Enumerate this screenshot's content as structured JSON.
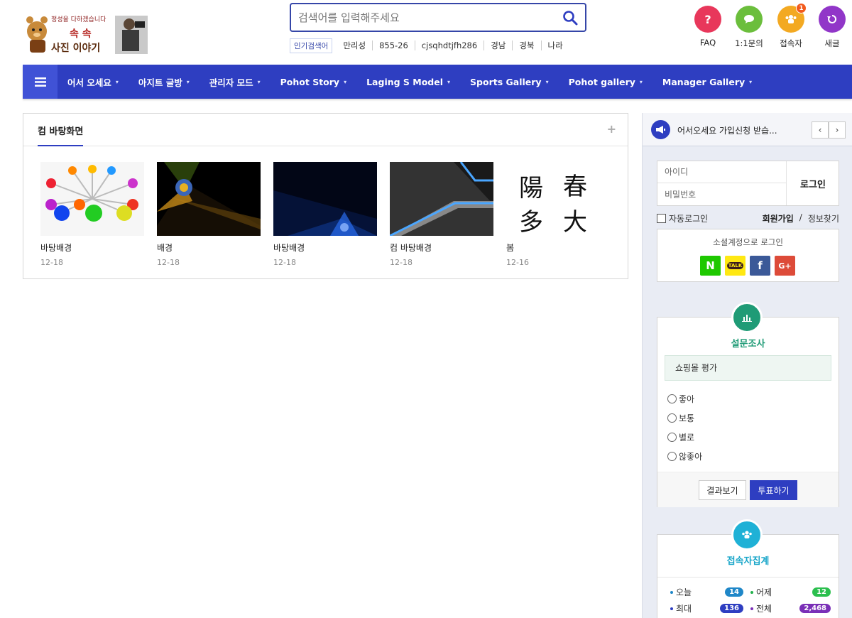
{
  "logo": {
    "line1": "정성을 다하겠습니다",
    "line2": "속 속",
    "line3": "사진 이야기"
  },
  "search": {
    "placeholder": "검색어를 입력해주세요",
    "value": ""
  },
  "popular": {
    "tag": "인기검색어",
    "keywords": [
      "만리성",
      "855-26",
      "cjsqhdtjfh286",
      "경남",
      "경북",
      "나라"
    ]
  },
  "quick_links": [
    {
      "label": "FAQ",
      "icon": "question-icon",
      "color": "#e8375b"
    },
    {
      "label": "1:1문의",
      "icon": "chat-icon",
      "color": "#6bbe3c"
    },
    {
      "label": "접속자",
      "icon": "users-icon",
      "color": "#f3a922",
      "badge": "1"
    },
    {
      "label": "새글",
      "icon": "refresh-icon",
      "color": "#9136c8"
    }
  ],
  "nav": {
    "items": [
      "어서 오세요",
      "아지트 글방",
      "관리자 모드",
      "Pohot Story",
      "Laging S Model",
      "Sports Gallery",
      "Pohot gallery",
      "Manager Gallery"
    ],
    "bg": "#2e3ec1"
  },
  "main": {
    "title": "컴 바탕화면",
    "items": [
      {
        "title": "바탕배경",
        "date": "12-18"
      },
      {
        "title": "배경",
        "date": "12-18"
      },
      {
        "title": "바탕배경",
        "date": "12-18"
      },
      {
        "title": "컴 바탕배경",
        "date": "12-18"
      },
      {
        "title": "봄",
        "date": "12-16"
      }
    ]
  },
  "sidebar": {
    "notice": "어서오세요 가입신청 받습...",
    "login": {
      "id_placeholder": "아이디",
      "pw_placeholder": "비밀번호",
      "button": "로그인",
      "auto_login": "자동로그인",
      "signup": "회원가입",
      "separator": "/",
      "find": "정보찾기"
    },
    "social": {
      "title": "소셜계정으로 로그인",
      "naver": "N",
      "kakao": "TALK",
      "facebook": "f",
      "google": "G+"
    },
    "poll": {
      "title": "설문조사",
      "question": "쇼핑몰 평가",
      "options": [
        "좋아",
        "보통",
        "별로",
        "않좋아"
      ],
      "result_button": "결과보기",
      "vote_button": "투표하기"
    },
    "visitors": {
      "title": "접속자집계",
      "today_label": "오늘",
      "today": "14",
      "yesterday_label": "어제",
      "yesterday": "12",
      "max_label": "최대",
      "max": "136",
      "total_label": "전체",
      "total": "2,468"
    }
  }
}
